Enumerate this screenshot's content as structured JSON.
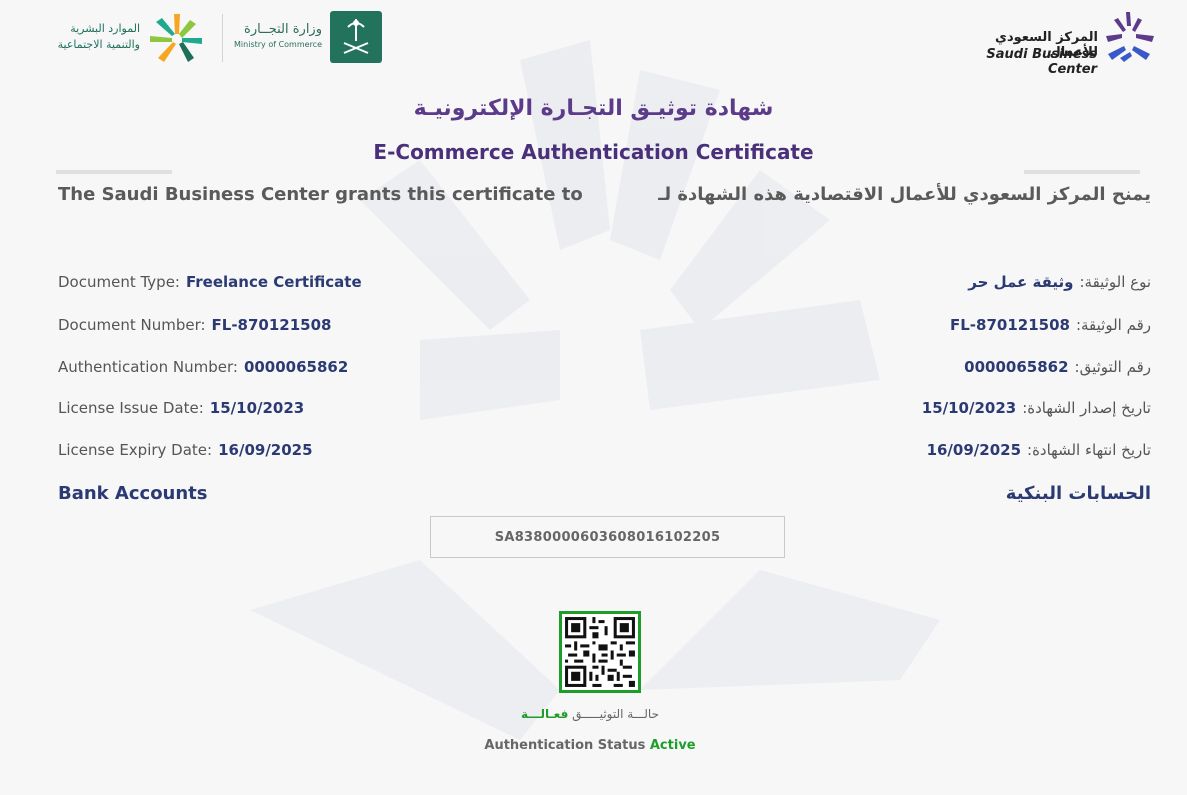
{
  "header": {
    "sbc_name_ar": "المركز السعودي للأعمال",
    "sbc_name_en": "Saudi Business Center",
    "moc_name_ar": "وزارة التجــارة",
    "moc_name_en": "Ministry of Commerce",
    "hrsd_name_ar_line1": "الموارد البشرية",
    "hrsd_name_ar_line2": "والتنمية الاجتماعية"
  },
  "title": {
    "ar": "شهادة توثيـق التجـارة الإلكترونيـة",
    "en": "E-Commerce Authentication Certificate"
  },
  "grant": {
    "en": "The Saudi Business Center grants this certificate to",
    "ar": "يمنح المركز السعودي للأعمال الاقتصادية هذه الشهادة لـ"
  },
  "fields_en": [
    {
      "label": "Document Type:",
      "value": "Freelance Certificate"
    },
    {
      "label": "Document Number:",
      "value": "FL-870121508"
    },
    {
      "label": "Authentication Number:",
      "value": "0000065862"
    },
    {
      "label": "License Issue Date:",
      "value": "15/10/2023"
    },
    {
      "label": "License Expiry Date:",
      "value": "16/09/2025"
    }
  ],
  "fields_ar": [
    {
      "label": "نوع الوثيقة:",
      "value": "وثيقة عمل حر"
    },
    {
      "label": "رقم الوثيقة:",
      "value": "FL-870121508"
    },
    {
      "label": "رقم التوثيق:",
      "value": "0000065862"
    },
    {
      "label": "تاريخ إصدار الشهادة:",
      "value": "15/10/2023"
    },
    {
      "label": "تاريخ انتهاء الشهادة:",
      "value": "16/09/2025"
    }
  ],
  "bank": {
    "title_en": "Bank Accounts",
    "title_ar": "الحسابات البنكية",
    "iban": "SA8380000603608016102205"
  },
  "status": {
    "label_ar": "حالـــة التوثيـــــق",
    "value_ar": "فعـالـــة",
    "label_en": "Authentication Status",
    "value_en": "Active"
  },
  "colors": {
    "title_purple": "#5b3b8a",
    "value_navy": "#2b3a73",
    "status_green": "#1f9d2a"
  }
}
